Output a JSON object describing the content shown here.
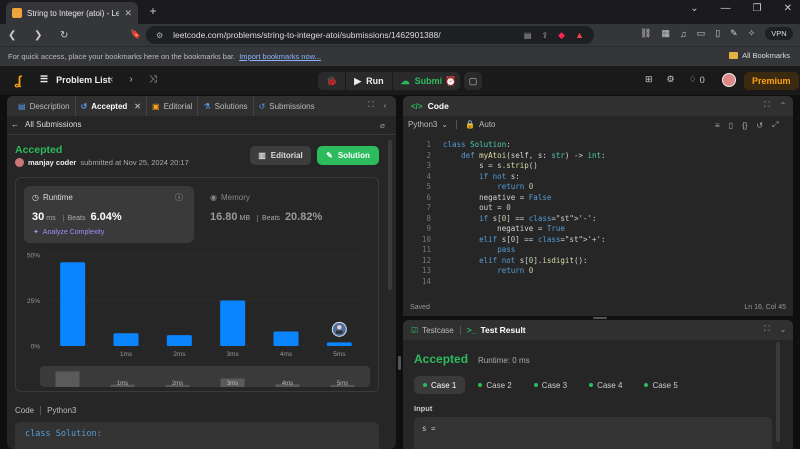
{
  "browser": {
    "tab_title": "String to Integer (atoi) - LeetCo",
    "url": "leetcode.com/problems/string-to-integer-atoi/submissions/1462901388/",
    "vpn_label": "VPN",
    "bookmarks_hint": "For quick access, place your bookmarks here on the bookmarks bar.",
    "bookmarks_import": "Import bookmarks now...",
    "all_bookmarks": "All Bookmarks"
  },
  "lc_nav": {
    "problem_list": "Problem List",
    "run": "Run",
    "submit": "Submit",
    "streak": "0",
    "premium": "Premium"
  },
  "left_tabs": [
    {
      "label": "Description",
      "icon": "description-icon"
    },
    {
      "label": "Accepted",
      "icon": "history-icon"
    },
    {
      "label": "Editorial",
      "icon": "book-icon"
    },
    {
      "label": "Solutions",
      "icon": "flask-icon"
    },
    {
      "label": "Submissions",
      "icon": "history-icon"
    }
  ],
  "submission": {
    "back_label": "All Submissions",
    "status": "Accepted",
    "user": "manjay coder",
    "submitted_text": "submitted at Nov 25, 2024 20:17",
    "editorial_btn": "Editorial",
    "solution_btn": "Solution",
    "runtime_label": "Runtime",
    "runtime_value": "30",
    "runtime_unit": "ms",
    "beats_label": "Beats",
    "runtime_beats": "6.04%",
    "analyze": "Analyze Complexity",
    "memory_label": "Memory",
    "memory_value": "16.80",
    "memory_unit": "MB",
    "memory_beats": "20.82%",
    "code_label": "Code",
    "code_lang": "Python3",
    "code_preview": "class Solution:"
  },
  "chart_data": {
    "type": "bar",
    "title": "",
    "xlabel": "",
    "ylabel": "",
    "y_ticks": [
      "50%",
      "25%",
      "0%"
    ],
    "ylim": [
      0,
      50
    ],
    "categories": [
      "0ms",
      "1ms",
      "2ms",
      "3ms",
      "4ms",
      "5ms"
    ],
    "x_tick_labels": [
      "1ms",
      "2ms",
      "3ms",
      "4ms",
      "5ms"
    ],
    "values": [
      46,
      7,
      6,
      25,
      8,
      2
    ],
    "bar_color": "#0a84ff",
    "your_submission_marker": "5ms",
    "grid": true
  },
  "code_panel": {
    "title": "Code",
    "lang": "Python3",
    "auto": "Auto",
    "saved": "Saved",
    "cursor": "Ln 16, Col 45",
    "lines": [
      {
        "n": "1",
        "t": "class Solution:"
      },
      {
        "n": "2",
        "t": "    def myAtoi(self, s: str) -> int:"
      },
      {
        "n": "3",
        "t": "        s = s.strip()"
      },
      {
        "n": "4",
        "t": "        if not s:"
      },
      {
        "n": "5",
        "t": "            return 0"
      },
      {
        "n": "6",
        "t": "        negative = False"
      },
      {
        "n": "7",
        "t": "        out = 0"
      },
      {
        "n": "8",
        "t": "        if s[0] == '-':"
      },
      {
        "n": "9",
        "t": "            negative = True"
      },
      {
        "n": "10",
        "t": "        elif s[0] == '+':"
      },
      {
        "n": "11",
        "t": "            pass"
      },
      {
        "n": "12",
        "t": "        elif not s[0].isdigit():"
      },
      {
        "n": "13",
        "t": "            return 0"
      },
      {
        "n": "14",
        "t": ""
      }
    ]
  },
  "result_panel": {
    "testcase_tab": "Testcase",
    "result_tab": "Test Result",
    "status": "Accepted",
    "runtime": "Runtime: 0 ms",
    "cases": [
      "Case 1",
      "Case 2",
      "Case 3",
      "Case 4",
      "Case 5"
    ],
    "input_label": "Input",
    "input_var": "s ="
  }
}
